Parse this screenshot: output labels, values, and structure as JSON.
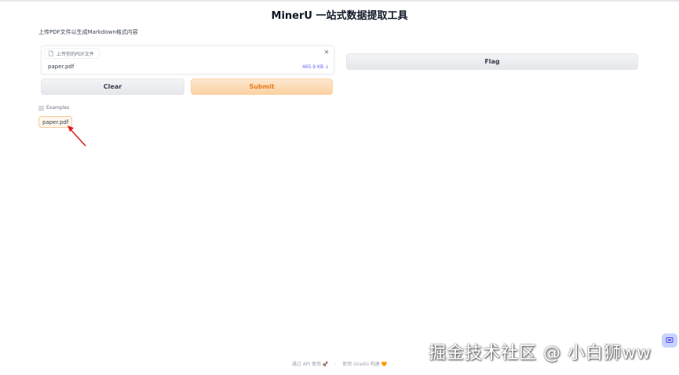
{
  "app": {
    "title": "MinerU 一站式数据提取工具"
  },
  "description": "上传PDF文件以生成Markdown格式内容",
  "upload": {
    "label": "上传你的PDF文件",
    "file_name": "paper.pdf",
    "file_size": "465.9 KB ↓",
    "remove_icon": "close-icon"
  },
  "buttons": {
    "clear": "Clear",
    "submit": "Submit",
    "flag": "Flag"
  },
  "examples": {
    "label": "Examples",
    "items": [
      "paper.pdf"
    ]
  },
  "footer": {
    "api": "通过 API 使用 🚀",
    "separator": "·",
    "built": "使用 Gradio 构建 🧡"
  },
  "watermark": "掘金技术社区 @ 小白狮ww",
  "colors": {
    "submit_text": "#ea7a1b",
    "submit_bg": "#fbd2a3",
    "accent": "#6366f1",
    "arrow": "#e11d1d"
  }
}
